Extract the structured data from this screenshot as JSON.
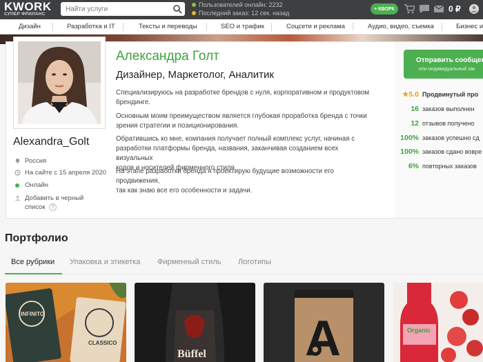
{
  "header": {
    "logo": "KWORK",
    "logo_sub": "СУПЕР ФРИЛАНС",
    "search_placeholder": "Найти услуги",
    "online_users": "Пользователей онлайн: 2232",
    "last_order": "Последний заказ: 12 сек. назад",
    "kwork_button": "+ КВОРК",
    "balance": "0 ₽"
  },
  "categories": [
    "Дизайн",
    "Разработка и IT",
    "Тексты и переводы",
    "SEO и трафик",
    "Соцсети и реклама",
    "Аудио, видео, съемка",
    "Бизнес и"
  ],
  "profile": {
    "username": "Alexandra_Golt",
    "country": "Россия",
    "since": "На сайте с 15 апреля 2020",
    "status": "Онлайн",
    "blacklist": [
      "Добавить в черный",
      "список"
    ],
    "name": "Александра Голт",
    "role": "Дизайнер, Маркетолог, Аналитик",
    "paragraphs": [
      [
        "Специализируюсь на разработке брендов с нуля, корпоративном и продуктовом",
        "брендинге."
      ],
      [
        "Основным моим преимуществом является глубокая проработка бренда с точки",
        "зрения стратегии и позиционирования."
      ],
      [
        "Обратившись ко мне, компания получает полный комплекс услуг, начиная с",
        "разработки платформы бренда, названия, заканчивая созданием всех визуальных",
        "кодов и носителей фирменного стиля."
      ],
      [
        "На этапе разработки бренда я проектирую будущие возможности его продвижения,",
        "так как знаю все его особенности и задачи."
      ]
    ]
  },
  "sidebar": {
    "send_title": "Отправить сообщен",
    "send_sub": "или индивидуальный зак",
    "stats": [
      {
        "num": "★5.0",
        "label": "Продвинутый про"
      },
      {
        "num": "16",
        "label": "заказов выполнен"
      },
      {
        "num": "12",
        "label": "отзывов получено"
      },
      {
        "num": "100%",
        "label": "заказов успешно сд"
      },
      {
        "num": "100%",
        "label": "заказов сдано вовре"
      },
      {
        "num": "6%",
        "label": "повторных заказов"
      }
    ]
  },
  "portfolio": {
    "title": "Портфолио",
    "tabs": [
      "Все рубрики",
      "Упаковка и этикетка",
      "Фирменный стиль",
      "Логотипы"
    ],
    "thumb_texts": {
      "t1a": "INFINITO",
      "t1b": "CLASSICO",
      "t2": "Büffel",
      "t3": "A",
      "t4": "Organic"
    }
  },
  "colors": {
    "accent": "#4caf50",
    "name": "#3fa23d",
    "header": "#3d3f41"
  }
}
